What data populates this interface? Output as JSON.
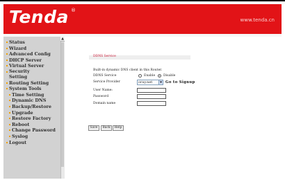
{
  "brand": {
    "logo_text": "Tenda",
    "logo_mark": "®",
    "website": "www.tenda.cn",
    "colors": {
      "header_red": "#e21317",
      "sidebar_gray": "#d2d2d2",
      "bullet_orange": "#f0a000"
    }
  },
  "nav": {
    "items": [
      {
        "label": "Status",
        "sub": false
      },
      {
        "label": "Wizard",
        "sub": false
      },
      {
        "label": "Advanced Config",
        "sub": false
      },
      {
        "label": "DHCP Server",
        "sub": false
      },
      {
        "label": "Virtual Server",
        "sub": false
      },
      {
        "label": "Security Setting",
        "sub": false
      },
      {
        "label": "Routing Setting",
        "sub": false
      },
      {
        "label": "System Tools",
        "sub": false
      },
      {
        "label": "Time Setting",
        "sub": true
      },
      {
        "label": "Dynamic DNS",
        "sub": true
      },
      {
        "label": "Backup/Restore",
        "sub": true
      },
      {
        "label": "Upgrade",
        "sub": true
      },
      {
        "label": "Restore Factory",
        "sub": true
      },
      {
        "label": "Reboot",
        "sub": true
      },
      {
        "label": "Change Password",
        "sub": true
      },
      {
        "label": "Syslog",
        "sub": true
      },
      {
        "label": "Logout",
        "sub": false
      }
    ]
  },
  "ddns": {
    "section_title": "DDNS Service",
    "description": "Built-in dynamic DNS client in this Router.",
    "service_label": "DDNS Service",
    "enable_label": "Enable",
    "disable_label": "Disable",
    "selected": "Disable",
    "provider_label": "Service Provider",
    "provider_value": "oray.net",
    "signup_link": "Go to Signup",
    "username_label": "User Name:",
    "username_value": "",
    "password_label": "Password",
    "password_value": "",
    "domain_label": "Domain name",
    "domain_value": ""
  },
  "buttons": {
    "save": "Save",
    "back": "Back",
    "help": "Help"
  }
}
